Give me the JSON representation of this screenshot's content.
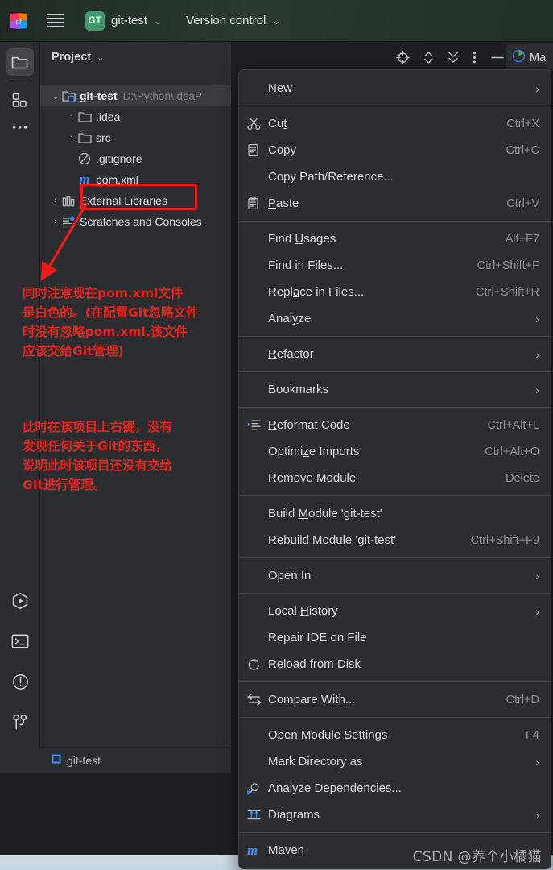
{
  "titlebar": {
    "logo_icon": "intellij-idea-logo",
    "menu_icon": "hamburger-menu-icon",
    "project_badge": "GT",
    "project_name": "git-test",
    "project_chevron": "chevron-down-icon",
    "version_control_label": "Version control",
    "version_control_chevron": "chevron-down-icon"
  },
  "toolstrip": {
    "items": [
      {
        "name": "project-tool-icon",
        "selected": true
      },
      {
        "name": "structure-tool-icon",
        "selected": false
      },
      {
        "name": "more-tool-windows-icon",
        "selected": false
      }
    ],
    "bottom_items": [
      {
        "name": "run-tool-icon"
      },
      {
        "name": "terminal-tool-icon"
      },
      {
        "name": "problems-tool-icon"
      },
      {
        "name": "version-control-tool-icon"
      }
    ]
  },
  "project_panel": {
    "title": "Project",
    "title_chevron": "chevron-down-icon",
    "actions": [
      {
        "name": "select-opened-file-icon"
      },
      {
        "name": "expand-collapse-icon"
      },
      {
        "name": "collapse-all-icon"
      },
      {
        "name": "more-options-icon"
      },
      {
        "name": "hide-icon"
      }
    ],
    "tree": [
      {
        "arrow": "v",
        "icon": "module-folder-icon",
        "label": "git-test",
        "path": "D:\\Python\\IdeaP",
        "bold": true,
        "selected": true,
        "indent": 0
      },
      {
        "arrow": ">",
        "icon": "folder-icon",
        "label": ".idea",
        "path": "",
        "bold": false,
        "selected": false,
        "indent": 1
      },
      {
        "arrow": ">",
        "icon": "folder-icon",
        "label": "src",
        "path": "",
        "bold": false,
        "selected": false,
        "indent": 1
      },
      {
        "arrow": "",
        "icon": "gitignore-icon",
        "label": ".gitignore",
        "path": "",
        "bold": false,
        "selected": false,
        "indent": 1
      },
      {
        "arrow": "",
        "icon": "maven-pom-icon",
        "label": "pom.xml",
        "path": "",
        "bold": false,
        "selected": false,
        "indent": 1
      },
      {
        "arrow": ">",
        "icon": "external-libraries-icon",
        "label": "External Libraries",
        "path": "",
        "bold": false,
        "selected": false,
        "indent": 0
      },
      {
        "arrow": ">",
        "icon": "scratches-icon",
        "label": "Scratches and Consoles",
        "path": "",
        "bold": false,
        "selected": false,
        "indent": 0
      }
    ]
  },
  "annotations": {
    "highlight_color": "#ee1c16",
    "note_1": "同时注意现在pom.xml文件\n是白色的。(在配置Git忽略文件\n时没有忽略pom.xml,该文件\n应该交给Git管理)",
    "note_2": "此时在该项目上右键，没有\n发现任何关于Git的东西，\n说明此时该项目还没有交给\nGIt进行管理。"
  },
  "context_menu": {
    "items": [
      {
        "type": "item",
        "icon": "",
        "label": "New",
        "underline": "N",
        "key": "",
        "submenu": true
      },
      {
        "type": "sep"
      },
      {
        "type": "item",
        "icon": "cut-icon",
        "label": "Cut",
        "underline": "t",
        "key": "Ctrl+X",
        "submenu": false
      },
      {
        "type": "item",
        "icon": "copy-icon",
        "label": "Copy",
        "underline": "C",
        "key": "Ctrl+C",
        "submenu": false
      },
      {
        "type": "item",
        "icon": "",
        "label": "Copy Path/Reference...",
        "underline": "",
        "key": "",
        "submenu": false
      },
      {
        "type": "item",
        "icon": "paste-icon",
        "label": "Paste",
        "underline": "P",
        "key": "Ctrl+V",
        "submenu": false
      },
      {
        "type": "sep"
      },
      {
        "type": "item",
        "icon": "",
        "label": "Find Usages",
        "underline": "U",
        "key": "Alt+F7",
        "submenu": false
      },
      {
        "type": "item",
        "icon": "",
        "label": "Find in Files...",
        "underline": "",
        "key": "Ctrl+Shift+F",
        "submenu": false
      },
      {
        "type": "item",
        "icon": "",
        "label": "Replace in Files...",
        "underline": "a",
        "key": "Ctrl+Shift+R",
        "submenu": false
      },
      {
        "type": "item",
        "icon": "",
        "label": "Analyze",
        "underline": "y",
        "key": "",
        "submenu": true
      },
      {
        "type": "sep"
      },
      {
        "type": "item",
        "icon": "",
        "label": "Refactor",
        "underline": "R",
        "key": "",
        "submenu": true
      },
      {
        "type": "sep"
      },
      {
        "type": "item",
        "icon": "",
        "label": "Bookmarks",
        "underline": "",
        "key": "",
        "submenu": true
      },
      {
        "type": "sep"
      },
      {
        "type": "item",
        "icon": "reformat-code-icon",
        "label": "Reformat Code",
        "underline": "R",
        "key": "Ctrl+Alt+L",
        "submenu": false
      },
      {
        "type": "item",
        "icon": "",
        "label": "Optimize Imports",
        "underline": "z",
        "key": "Ctrl+Alt+O",
        "submenu": false
      },
      {
        "type": "item",
        "icon": "",
        "label": "Remove Module",
        "underline": "",
        "key": "Delete",
        "submenu": false
      },
      {
        "type": "sep"
      },
      {
        "type": "item",
        "icon": "",
        "label": "Build Module 'git-test'",
        "underline": "M",
        "key": "",
        "submenu": false
      },
      {
        "type": "item",
        "icon": "",
        "label": "Rebuild Module 'git-test'",
        "underline": "e",
        "key": "Ctrl+Shift+F9",
        "submenu": false
      },
      {
        "type": "sep"
      },
      {
        "type": "item",
        "icon": "",
        "label": "Open In",
        "underline": "",
        "key": "",
        "submenu": true
      },
      {
        "type": "sep"
      },
      {
        "type": "item",
        "icon": "",
        "label": "Local History",
        "underline": "H",
        "key": "",
        "submenu": true
      },
      {
        "type": "item",
        "icon": "",
        "label": "Repair IDE on File",
        "underline": "",
        "key": "",
        "submenu": false
      },
      {
        "type": "item",
        "icon": "reload-from-disk-icon",
        "label": "Reload from Disk",
        "underline": "",
        "key": "",
        "submenu": false
      },
      {
        "type": "sep"
      },
      {
        "type": "item",
        "icon": "compare-with-icon",
        "label": "Compare With...",
        "underline": "",
        "key": "Ctrl+D",
        "submenu": false
      },
      {
        "type": "sep"
      },
      {
        "type": "item",
        "icon": "",
        "label": "Open Module Settings",
        "underline": "",
        "key": "F4",
        "submenu": false
      },
      {
        "type": "item",
        "icon": "",
        "label": "Mark Directory as",
        "underline": "",
        "key": "",
        "submenu": true
      },
      {
        "type": "item",
        "icon": "analyze-dependencies-icon",
        "label": "Analyze Dependencies...",
        "underline": "",
        "key": "",
        "submenu": false
      },
      {
        "type": "item",
        "icon": "diagrams-icon",
        "label": "Diagrams",
        "underline": "",
        "key": "",
        "submenu": true
      },
      {
        "type": "sep"
      },
      {
        "type": "item",
        "icon": "maven-icon",
        "label": "Maven",
        "underline": "",
        "key": "",
        "submenu": true
      }
    ]
  },
  "maven_tab": {
    "icon": "maven-tool-icon",
    "label": "Ma"
  },
  "status_bar": {
    "icon": "module-icon",
    "label": "git-test"
  },
  "watermark": "CSDN @养个小橘猫"
}
